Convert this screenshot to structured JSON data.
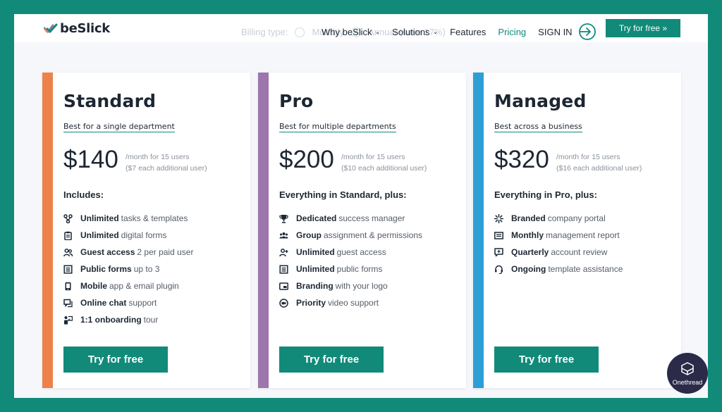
{
  "brand": {
    "name": "beSlick"
  },
  "billing": {
    "label": "Billing type:",
    "monthly": "Monthly",
    "annual": "Annual (save 17%)"
  },
  "nav": {
    "items": [
      {
        "label": "Why beSlick",
        "dropdown": true
      },
      {
        "label": "Solutions",
        "dropdown": true
      },
      {
        "label": "Features",
        "dropdown": false
      },
      {
        "label": "Pricing",
        "dropdown": false,
        "active": true
      }
    ],
    "signin": "SIGN IN",
    "cta": "Try for free »"
  },
  "plans": [
    {
      "name": "Standard",
      "subtitle": "Best for a single department",
      "price": "$140",
      "note1": "/month for 15 users",
      "note2": "($7 each additional user)",
      "includes": "Includes:",
      "accent": "#ec8249",
      "features": [
        {
          "bold": "Unlimited",
          "rest": "tasks & templates",
          "icon": "workflow-icon"
        },
        {
          "bold": "Unlimited",
          "rest": "digital forms",
          "icon": "clipboard-icon"
        },
        {
          "bold": "Guest access",
          "rest": "2 per paid user",
          "icon": "users-icon"
        },
        {
          "bold": "Public forms",
          "rest": "up to 3",
          "icon": "form-icon"
        },
        {
          "bold": "Mobile",
          "rest": "app & email plugin",
          "icon": "mobile-icon"
        },
        {
          "bold": "Online chat",
          "rest": "support",
          "icon": "chat-icon"
        },
        {
          "bold": "1:1 onboarding",
          "rest": "tour",
          "icon": "presenter-icon"
        }
      ],
      "cta": "Try for free"
    },
    {
      "name": "Pro",
      "subtitle": "Best for multiple departments",
      "price": "$200",
      "note1": "/month for 15 users",
      "note2": "($10 each additional user)",
      "includes": "Everything in Standard, plus:",
      "accent": "#9c76ad",
      "features": [
        {
          "bold": "Dedicated",
          "rest": "success manager",
          "icon": "trophy-icon"
        },
        {
          "bold": "Group",
          "rest": "assignment & permissions",
          "icon": "group-icon"
        },
        {
          "bold": "Unlimited",
          "rest": "guest access",
          "icon": "add-user-icon"
        },
        {
          "bold": "Unlimited",
          "rest": "public forms",
          "icon": "form-icon"
        },
        {
          "bold": "Branding",
          "rest": "with your logo",
          "icon": "branding-icon"
        },
        {
          "bold": "Priority",
          "rest": "video support",
          "icon": "video-icon"
        }
      ],
      "cta": "Try for free"
    },
    {
      "name": "Managed",
      "subtitle": "Best across a business",
      "price": "$320",
      "note1": "/month for 15 users",
      "note2": "($16 each additional user)",
      "includes": "Everything in Pro, plus:",
      "accent": "#2d9ed6",
      "features": [
        {
          "bold": "Branded",
          "rest": "company portal",
          "icon": "sparkle-icon"
        },
        {
          "bold": "Monthly",
          "rest": "management report",
          "icon": "report-icon"
        },
        {
          "bold": "Quarterly",
          "rest": "account review",
          "icon": "review-icon"
        },
        {
          "bold": "Ongoing",
          "rest": "template assistance",
          "icon": "headset-icon"
        }
      ],
      "cta": "Try for free"
    }
  ],
  "watermark": {
    "label": "Onethread"
  },
  "colors": {
    "frame": "#118a79",
    "primary": "#118a79",
    "text": "#1d2733",
    "muted": "#8b929b",
    "badge": "#2b2a49"
  }
}
